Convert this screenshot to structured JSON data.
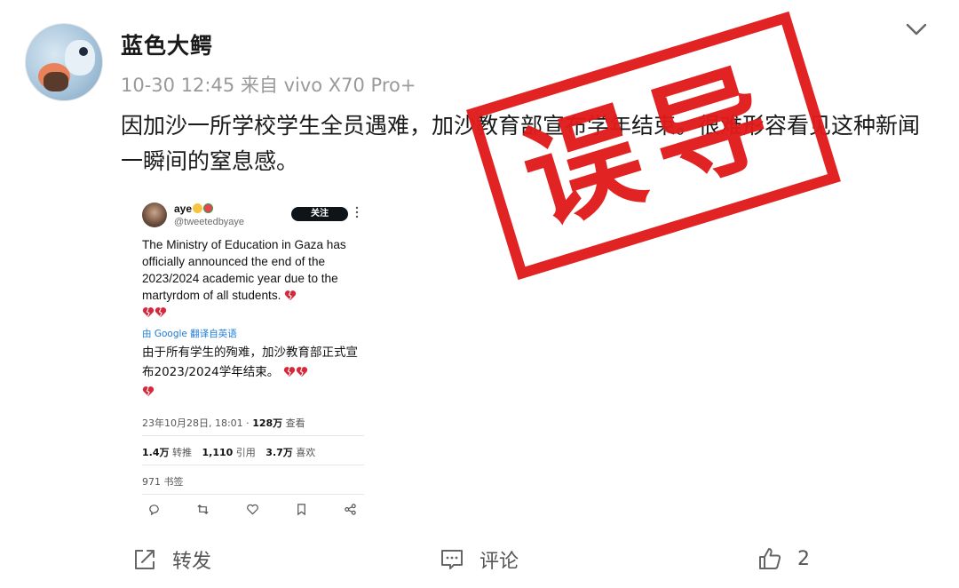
{
  "post": {
    "username": "蓝色大鳄",
    "meta": "10-30 12:45  来自 vivo X70 Pro+",
    "text": "因加沙一所学校学生全员遇难，加沙教育部宣布学年结束。很难形容看见这种新闻一瞬间的窒息感。"
  },
  "tweet": {
    "name": "aye",
    "handle": "@tweetedbyaye",
    "follow_label": "关注",
    "body": "The Ministry of Education in Gaza has officially announced the end of the 2023/2024 academic year due to the martyrdom of all students.",
    "translated_by": "由 Google 翻译自英语",
    "translation": "由于所有学生的殉难，加沙教育部正式宣布2023/2024学年结束。",
    "timestamp": "23年10月28日, 18:01 · ",
    "views_count": "128万",
    "views_label": " 查看",
    "reposts_count": "1.4万",
    "reposts_label": " 转推",
    "quotes_count": "1,110",
    "quotes_label": " 引用",
    "likes_count": "3.7万",
    "likes_label": " 喜欢",
    "bookmarks": "971 书签"
  },
  "stamp": {
    "text": "误导",
    "color": "#e01b1b"
  },
  "actions": {
    "repost_label": "转发",
    "comment_label": "评论",
    "like_count": "2"
  }
}
